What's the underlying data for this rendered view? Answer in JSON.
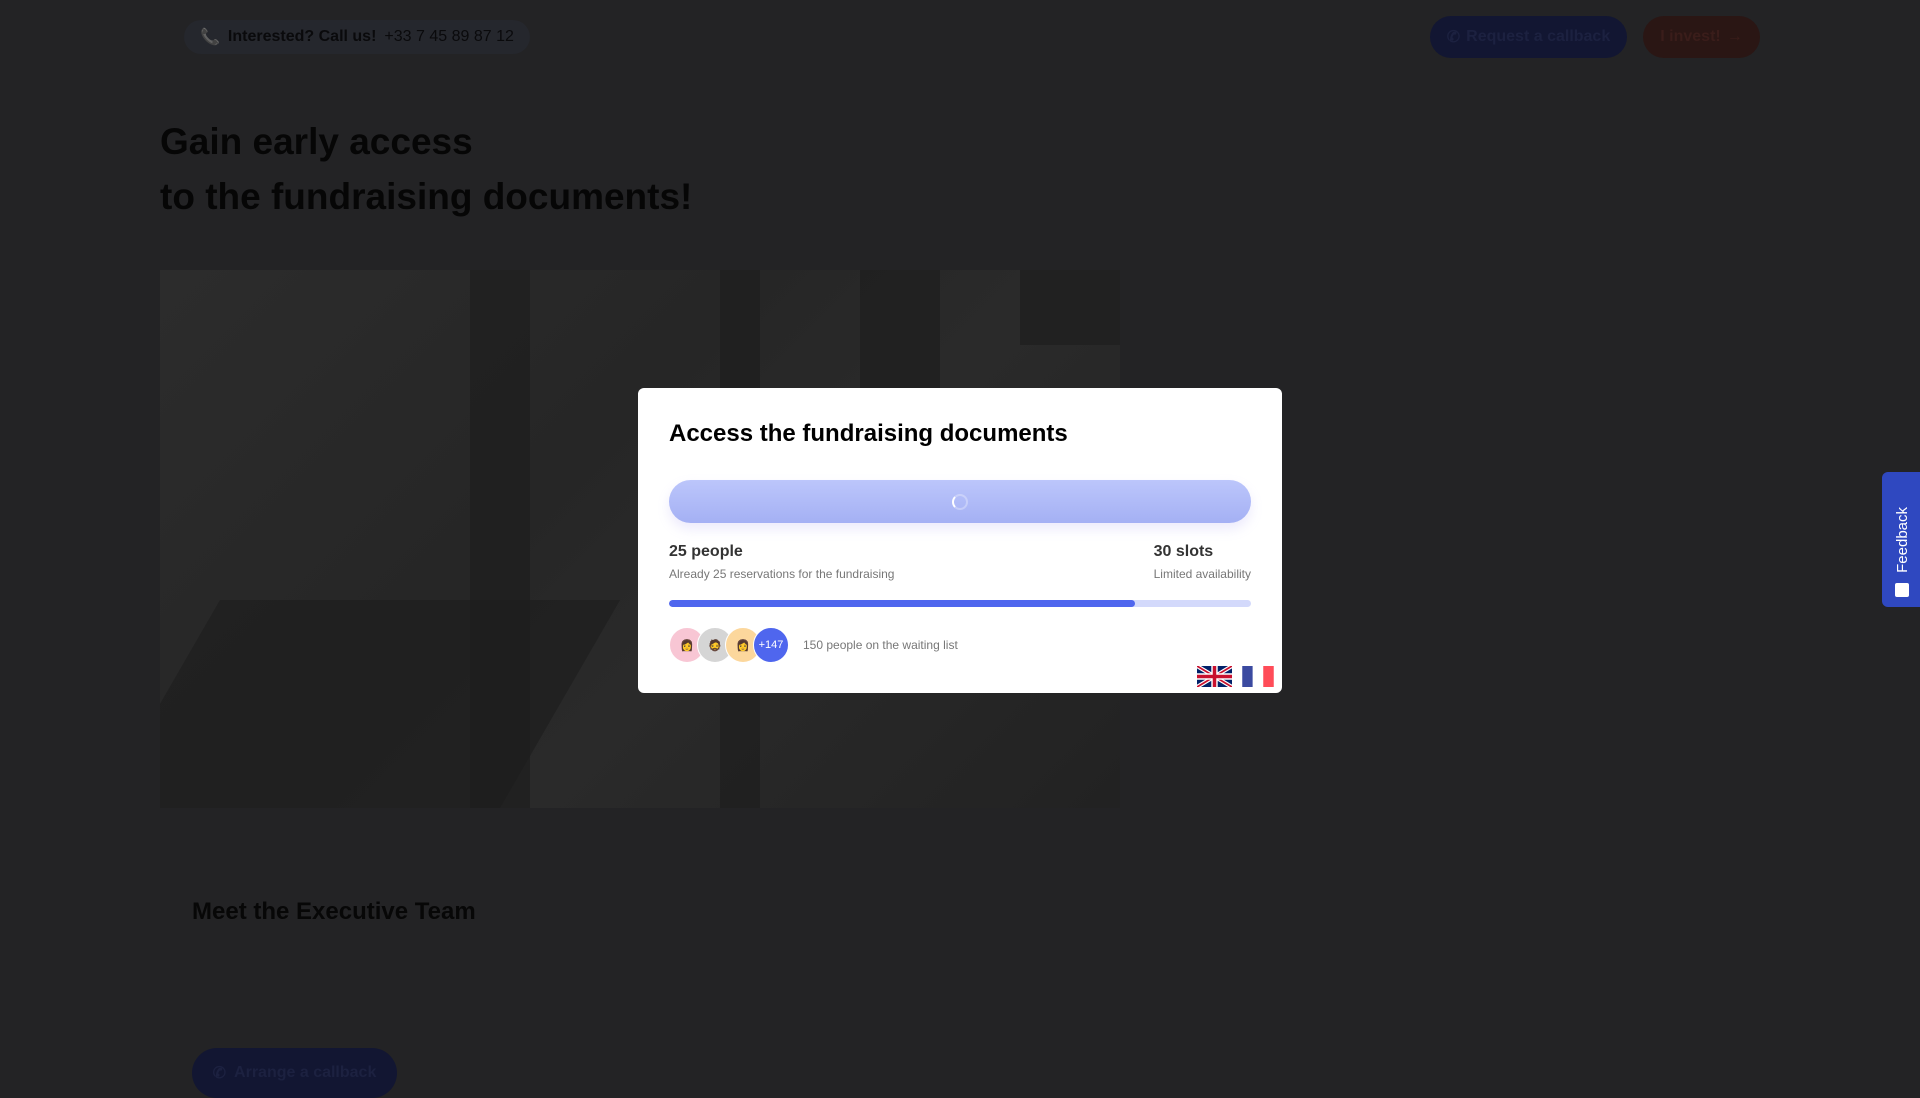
{
  "topbar": {
    "call_prefix": "Interested? Call us!",
    "phone": "+33 7 45 89 87 12",
    "request_callback": "Request a callback",
    "invest": "I invest!"
  },
  "hero": {
    "title_line1": "Gain early access",
    "title_line2": "to the fundraising documents!"
  },
  "modal": {
    "title": "Access the fundraising documents",
    "people": "25 people",
    "people_sub": "Already 25 reservations for the fundraising",
    "slots": "30 slots",
    "slots_sub": "Limited availability",
    "progress": 0.8,
    "more_count": "+147",
    "waiting": "150 people on the waiting list",
    "languages": [
      "English",
      "Français"
    ]
  },
  "team": {
    "title": "Meet the Executive Team",
    "arrange_callback": "Arrange a callback"
  },
  "feedback": {
    "label": "Feedback"
  },
  "colors": {
    "accent": "#4f66ee",
    "feedback": "#2f48c0"
  }
}
